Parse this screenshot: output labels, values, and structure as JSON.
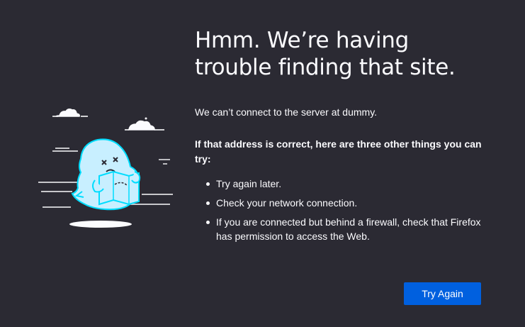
{
  "error": {
    "title": "Hmm. We’re having trouble finding that site.",
    "description": "We can’t connect to the server at dummy.",
    "suggestions_heading": "If that address is correct, here are three other things you can try:",
    "suggestions": [
      "Try again later.",
      "Check your network connection.",
      "If you are connected but behind a firewall, check that Firefox has permission to access the Web."
    ]
  },
  "actions": {
    "try_again_label": "Try Again"
  },
  "illustration": {
    "icon": "confused-dino-with-map-icon"
  },
  "colors": {
    "background": "#2b2a33",
    "text": "#fbfbfe",
    "accent": "#0060df",
    "illustration_fill": "#c8efff",
    "illustration_outline": "#00ddff"
  }
}
